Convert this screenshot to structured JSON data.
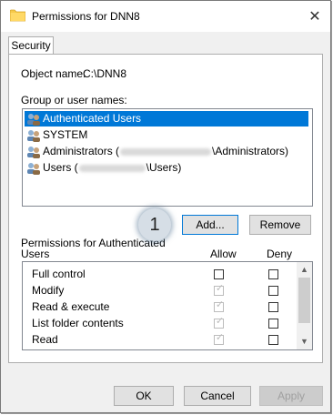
{
  "window": {
    "title": "Permissions for DNN8",
    "close_glyph": "✕"
  },
  "tabs": [
    {
      "label": "Security",
      "active": true
    }
  ],
  "object": {
    "label": "Object name:",
    "value": "C:\\DNN8"
  },
  "groups": {
    "label": "Group or user names:",
    "items": [
      {
        "label": "Authenticated Users",
        "selected": true
      },
      {
        "label": "SYSTEM"
      },
      {
        "prefix": "Administrators (",
        "suffix": "\\Administrators)",
        "redacted": true
      },
      {
        "prefix": "Users (",
        "suffix": "\\Users)",
        "redacted": true
      }
    ]
  },
  "buttons": {
    "add": "Add...",
    "remove": "Remove",
    "ok": "OK",
    "cancel": "Cancel",
    "apply": "Apply"
  },
  "callout": "1",
  "permissions": {
    "label_line1": "Permissions for Authenticated",
    "label_line2": "Users",
    "allow_header": "Allow",
    "deny_header": "Deny",
    "rows": [
      {
        "name": "Full control",
        "allow": false,
        "allow_disabled": false,
        "deny": false
      },
      {
        "name": "Modify",
        "allow": true,
        "allow_disabled": true,
        "deny": false
      },
      {
        "name": "Read & execute",
        "allow": true,
        "allow_disabled": true,
        "deny": false
      },
      {
        "name": "List folder contents",
        "allow": true,
        "allow_disabled": true,
        "deny": false
      },
      {
        "name": "Read",
        "allow": true,
        "allow_disabled": true,
        "deny": false
      }
    ]
  },
  "colors": {
    "selection": "#0078d7",
    "window_bg": "#f0f0f0",
    "callout": "#d6dee6"
  }
}
